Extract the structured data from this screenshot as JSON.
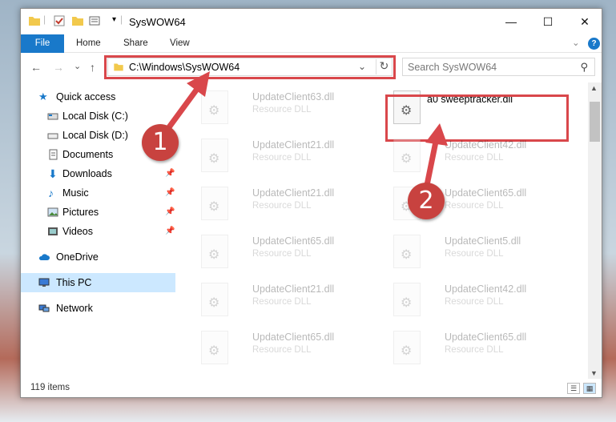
{
  "window": {
    "title": "SysWOW64",
    "minimize": "—",
    "maximize": "☐",
    "close": "✕"
  },
  "ribbon": {
    "tabs": [
      "File",
      "Home",
      "Share",
      "View"
    ],
    "expand": "⌄",
    "help": "?"
  },
  "nav": {
    "back": "←",
    "forward": "→",
    "recent": "⌄",
    "up": "↑"
  },
  "address": {
    "path": "C:\\Windows\\SysWOW64",
    "dropdown": "⌄",
    "refresh": "↻"
  },
  "search": {
    "placeholder": "Search SysWOW64",
    "icon": "⚲"
  },
  "sidebar": {
    "items": [
      {
        "label": "Quick access",
        "icon": "star-icon"
      },
      {
        "label": "Local Disk (C:)",
        "icon": "drive-icon"
      },
      {
        "label": "Local Disk (D:)",
        "icon": "drive-icon"
      },
      {
        "label": "Documents",
        "icon": "documents-icon",
        "pinned": true
      },
      {
        "label": "Downloads",
        "icon": "downloads-icon",
        "pinned": true
      },
      {
        "label": "Music",
        "icon": "music-icon",
        "pinned": true
      },
      {
        "label": "Pictures",
        "icon": "pictures-icon",
        "pinned": true
      },
      {
        "label": "Videos",
        "icon": "videos-icon",
        "pinned": true
      },
      {
        "label": "OneDrive",
        "icon": "cloud-icon"
      },
      {
        "label": "This PC",
        "icon": "computer-icon",
        "selected": true
      },
      {
        "label": "Network",
        "icon": "network-icon"
      }
    ]
  },
  "files": {
    "col1": [
      {
        "name": "UpdateClient63.dll",
        "type": "Resource DLL"
      },
      {
        "name": "UpdateClient21.dll",
        "type": "Resource DLL"
      },
      {
        "name": "UpdateClient21.dll",
        "type": "Resource DLL"
      },
      {
        "name": "UpdateClient65.dll",
        "type": "Resource DLL"
      },
      {
        "name": "UpdateClient21.dll",
        "type": "Resource DLL"
      },
      {
        "name": "UpdateClient65.dll",
        "type": "Resource DLL"
      }
    ],
    "col2": [
      {
        "name": "a0 sweeptracker.dll",
        "type": ""
      },
      {
        "name": "UpdateClient42.dll",
        "type": "Resource DLL"
      },
      {
        "name": "UpdateClient65.dll",
        "type": "Resource DLL"
      },
      {
        "name": "UpdateClient5.dll",
        "type": "Resource DLL"
      },
      {
        "name": "UpdateClient42.dll",
        "type": "Resource DLL"
      },
      {
        "name": "UpdateClient65.dll",
        "type": "Resource DLL"
      }
    ]
  },
  "status": {
    "count": "119 items"
  },
  "callouts": {
    "one": "1",
    "two": "2"
  },
  "colors": {
    "accent": "#1979ca",
    "highlight": "#d9474b",
    "selected": "#cce8ff"
  }
}
